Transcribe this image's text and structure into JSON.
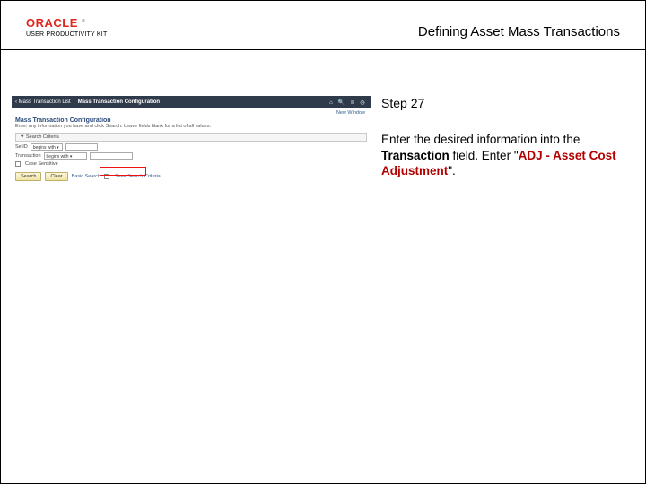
{
  "header": {
    "logo_brand": "ORACLE",
    "logo_sub": "USER PRODUCTIVITY KIT",
    "doc_title": "Defining Asset Mass Transactions"
  },
  "thumb": {
    "back_label": "‹ Mass Transaction List",
    "tab_label": "Mass Transaction Configuration",
    "section_title": "Mass Transaction Configuration",
    "help_text": "Enter any information you have and click Search. Leave fields blank for a list of all values.",
    "collapse_label": "▼ Search Criteria",
    "row_setid_label": "SetID",
    "row_setid_value": "begins with ▾",
    "row_trans_label": "Transaction",
    "row_trans_value": "begins with ▾",
    "case_label": "Case Sensitive",
    "btn_search": "Search",
    "btn_clear": "Clear",
    "link_basic": "Basic Search",
    "link_save": "Save Search Criteria",
    "new_window": "New Window"
  },
  "instruction": {
    "step": "Step 27",
    "pre": "Enter the desired information into the ",
    "field_name": "Transaction",
    "mid": " field. Enter \"",
    "value": "ADJ - Asset Cost Adjustment",
    "post": "\"."
  }
}
